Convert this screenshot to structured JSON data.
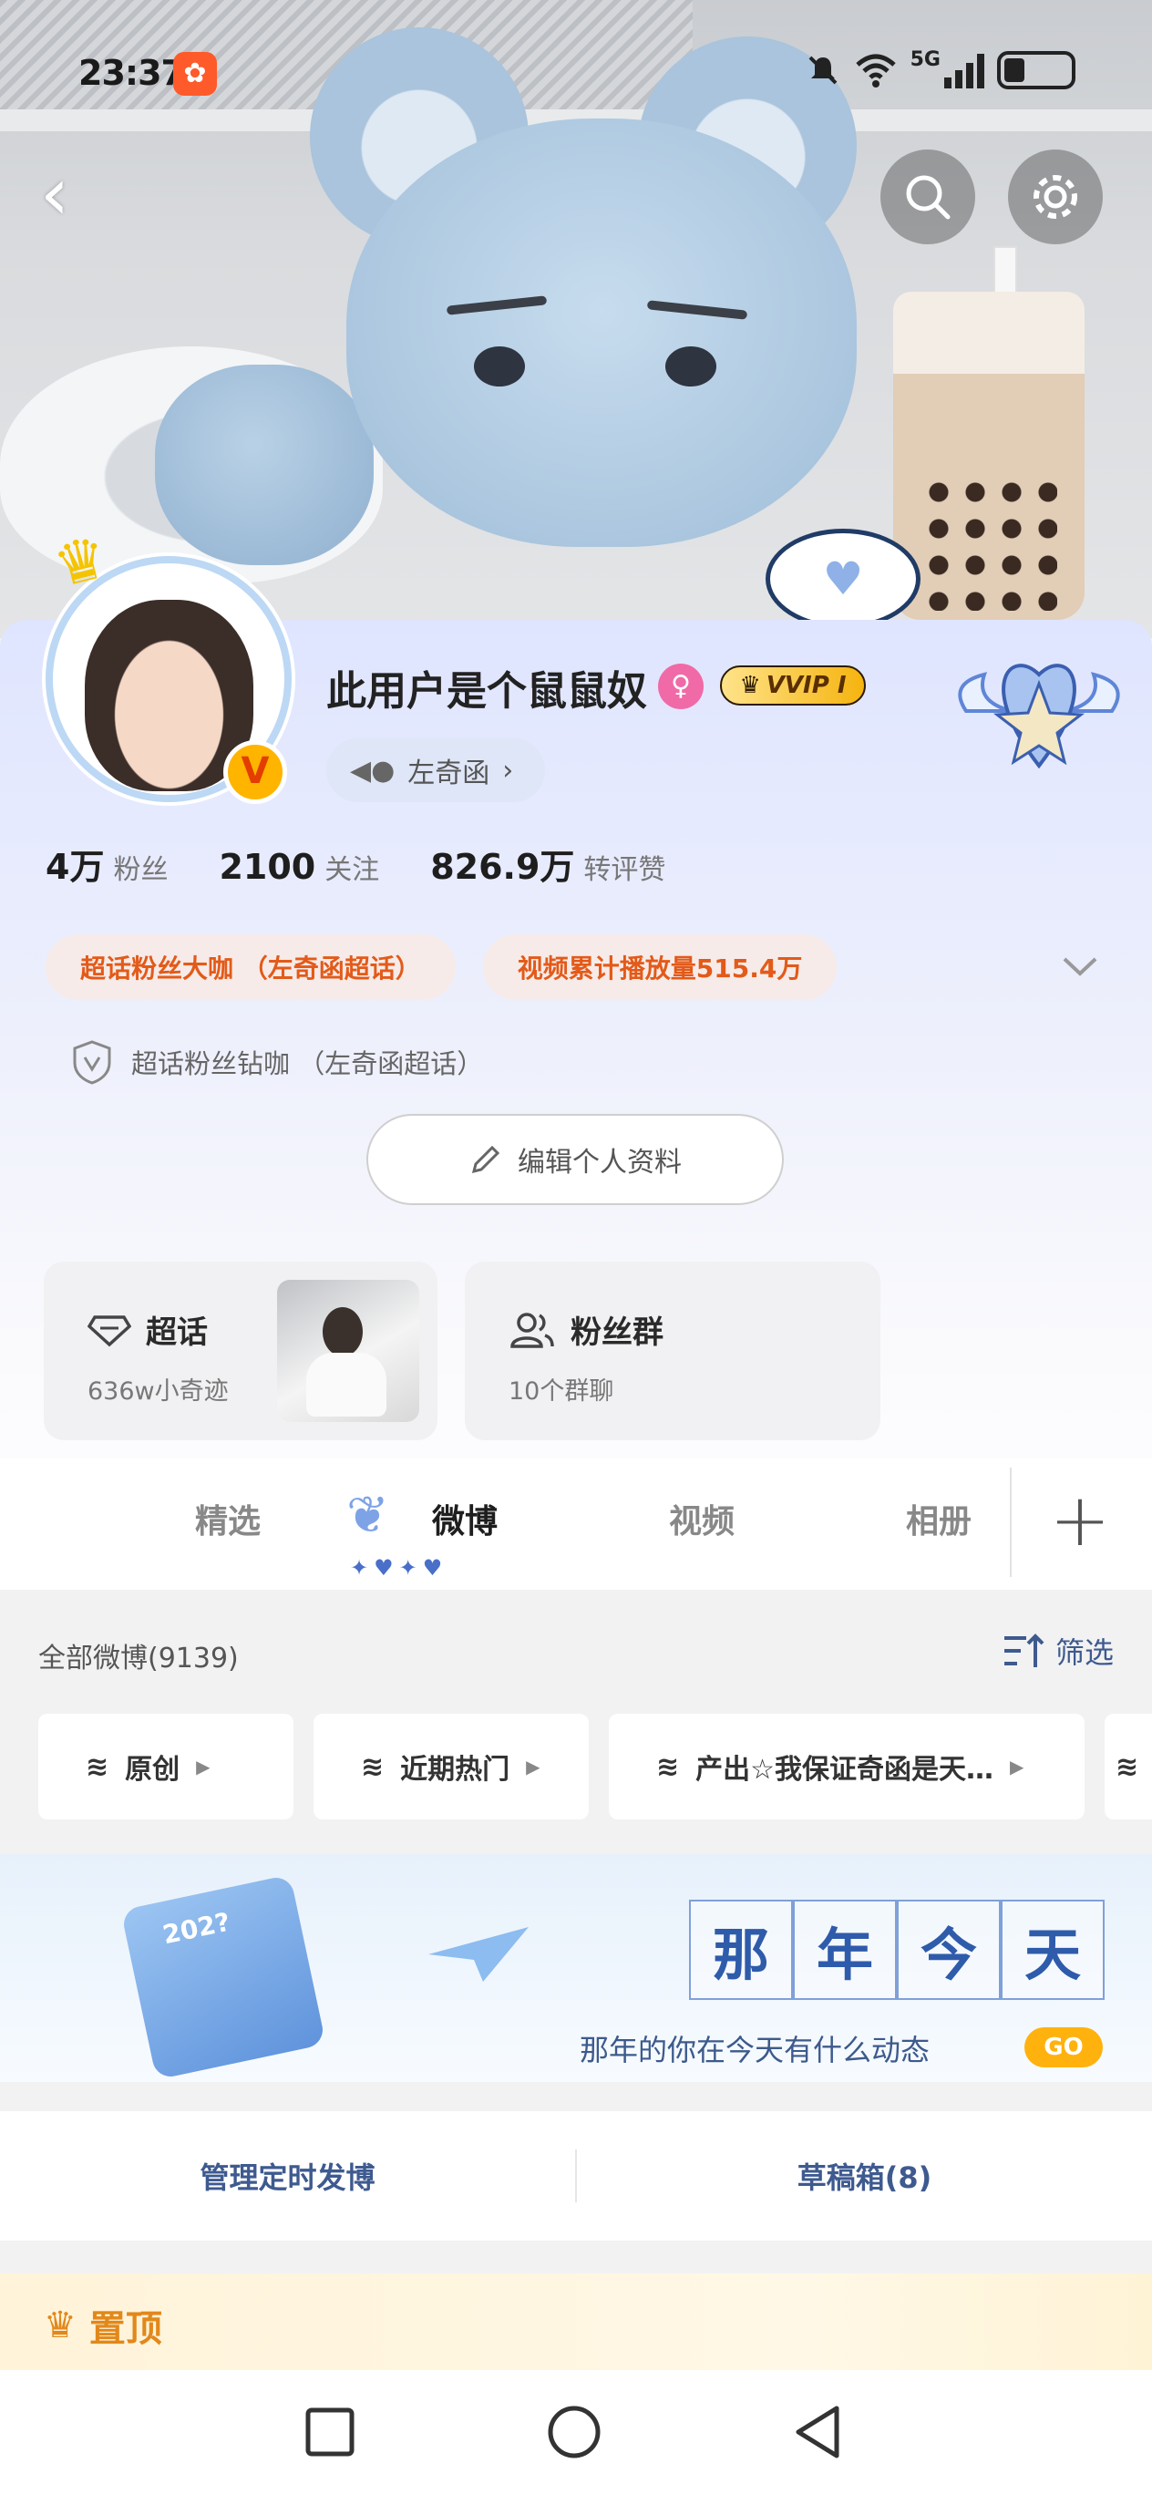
{
  "status_bar": {
    "time": "23:37",
    "network": "5G"
  },
  "profile": {
    "nickname": "此用户是个鼠鼠奴",
    "vip_label": "VVIP I",
    "fan_of": "左奇函",
    "stats": [
      {
        "num": "4万",
        "label": "粉丝"
      },
      {
        "num": "2100",
        "label": "关注"
      },
      {
        "num": "826.9万",
        "label": "转评赞"
      }
    ],
    "honors": [
      "超话粉丝大咖 （左奇函超话）",
      "视频累计播放量515.4万"
    ],
    "diamond_honor": "超话粉丝钻咖 （左奇函超话）",
    "edit_button": "编辑个人资料"
  },
  "cards": {
    "super_topic": {
      "title": "超话",
      "sub": "636w小奇迹"
    },
    "fan_group": {
      "title": "粉丝群",
      "sub": "10个群聊"
    }
  },
  "tabs": [
    {
      "label": "精选",
      "active": false
    },
    {
      "label": "微博",
      "active": true
    },
    {
      "label": "视频",
      "active": false
    },
    {
      "label": "相册",
      "active": false
    }
  ],
  "feed": {
    "all_label": "全部微博(9139)",
    "filter_label": "筛选",
    "chips": [
      "原创",
      "近期热门",
      "产出☆我保证奇函是天…"
    ]
  },
  "banner": {
    "title_chars": [
      "那",
      "年",
      "今",
      "天"
    ],
    "subtitle": "那年的你在今天有什么动态",
    "go": "GO",
    "calendar_year": "202?"
  },
  "manage": {
    "scheduled": "管理定时发博",
    "drafts": "草稿箱(8)"
  },
  "pinned": {
    "label": "置顶"
  },
  "colors": {
    "accent": "#3e5a8f",
    "honor": "#e35a19",
    "vip": "#f5b40f",
    "pin": "#e2881b"
  }
}
